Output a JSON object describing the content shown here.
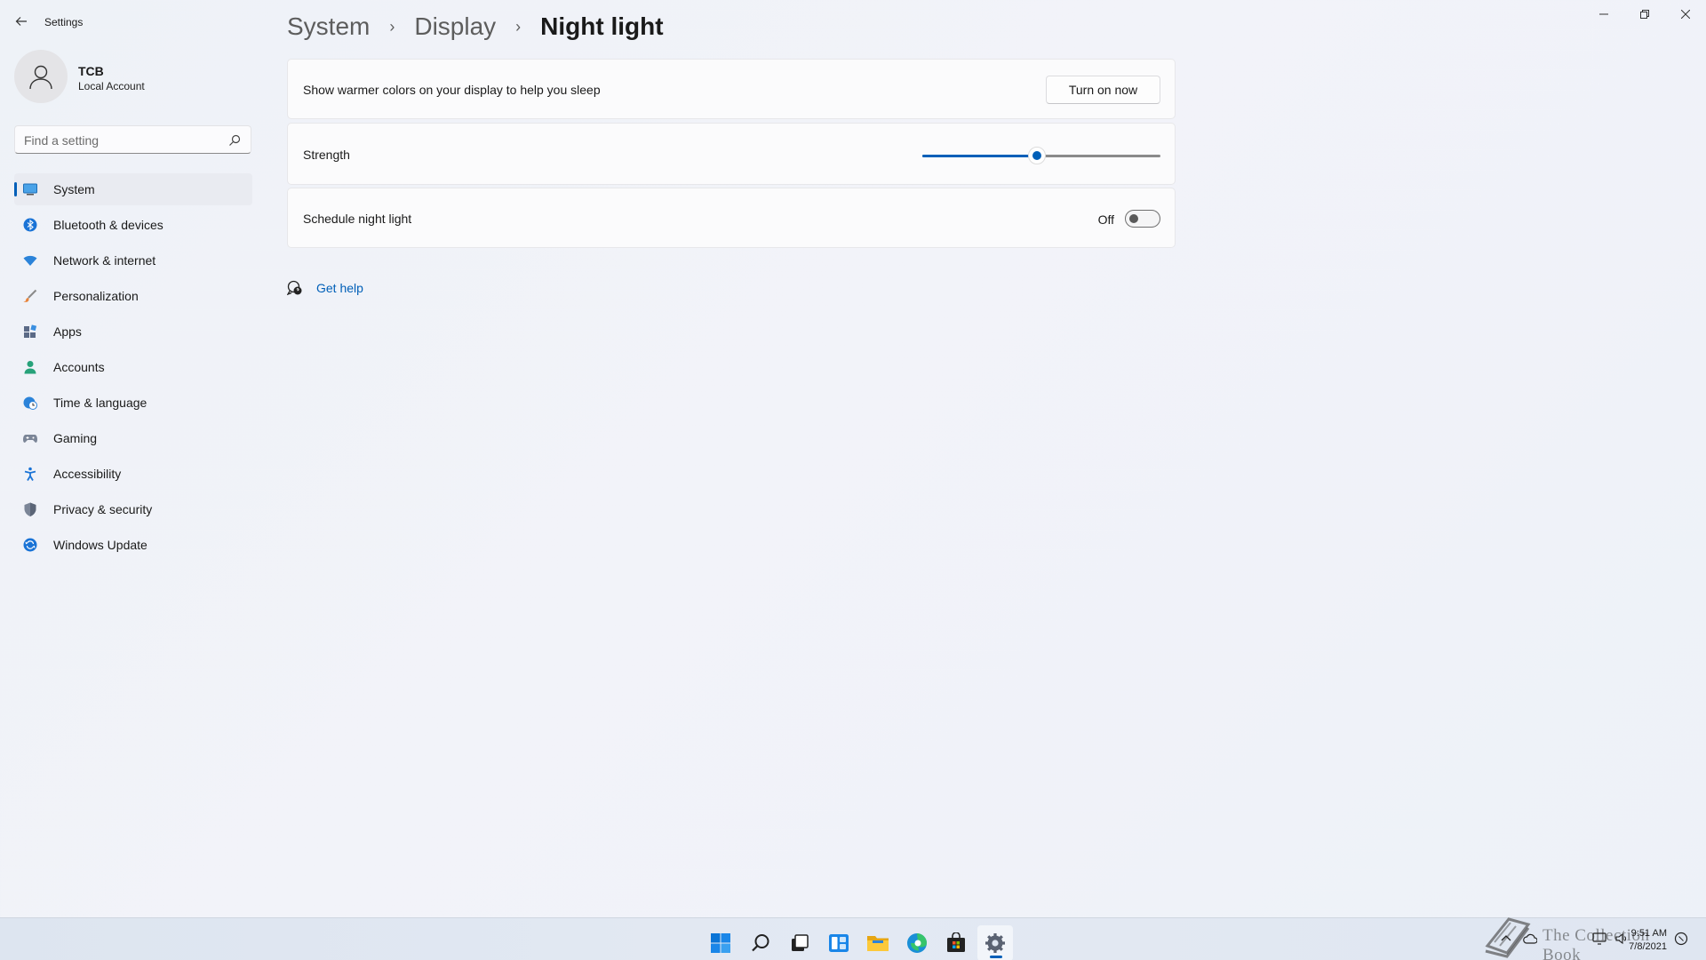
{
  "window": {
    "title": "Settings",
    "controls": {
      "minimize": "minimize",
      "maximize": "restore",
      "close": "close"
    }
  },
  "profile": {
    "name": "TCB",
    "account_type": "Local Account"
  },
  "search": {
    "placeholder": "Find a setting"
  },
  "sidebar": {
    "items": [
      {
        "label": "System",
        "icon": "monitor-icon",
        "active": true
      },
      {
        "label": "Bluetooth & devices",
        "icon": "bluetooth-icon"
      },
      {
        "label": "Network & internet",
        "icon": "wifi-icon"
      },
      {
        "label": "Personalization",
        "icon": "brush-icon"
      },
      {
        "label": "Apps",
        "icon": "apps-icon"
      },
      {
        "label": "Accounts",
        "icon": "person-icon"
      },
      {
        "label": "Time & language",
        "icon": "globe-clock-icon"
      },
      {
        "label": "Gaming",
        "icon": "gamepad-icon"
      },
      {
        "label": "Accessibility",
        "icon": "accessibility-icon"
      },
      {
        "label": "Privacy & security",
        "icon": "shield-icon"
      },
      {
        "label": "Windows Update",
        "icon": "update-icon"
      }
    ]
  },
  "breadcrumb": {
    "items": [
      "System",
      "Display"
    ],
    "current": "Night light"
  },
  "cards": {
    "warm_colors": {
      "label": "Show warmer colors on your display to help you sleep",
      "button": "Turn on now"
    },
    "strength": {
      "label": "Strength",
      "value": 0.48
    },
    "schedule": {
      "label": "Schedule night light",
      "state": "Off",
      "enabled": false
    }
  },
  "help": {
    "label": "Get help"
  },
  "taskbar": {
    "apps": [
      "start-icon",
      "search-icon",
      "task-view-icon",
      "widgets-icon",
      "file-explorer-icon",
      "edge-icon",
      "store-icon",
      "settings-icon"
    ],
    "active_app": "settings-icon",
    "clock": {
      "time": "9:51 AM",
      "date": "7/8/2021"
    }
  },
  "watermark": {
    "text": "The Collection Book"
  },
  "colors": {
    "accent": "#005fb8",
    "background": "#f1f3f8"
  }
}
